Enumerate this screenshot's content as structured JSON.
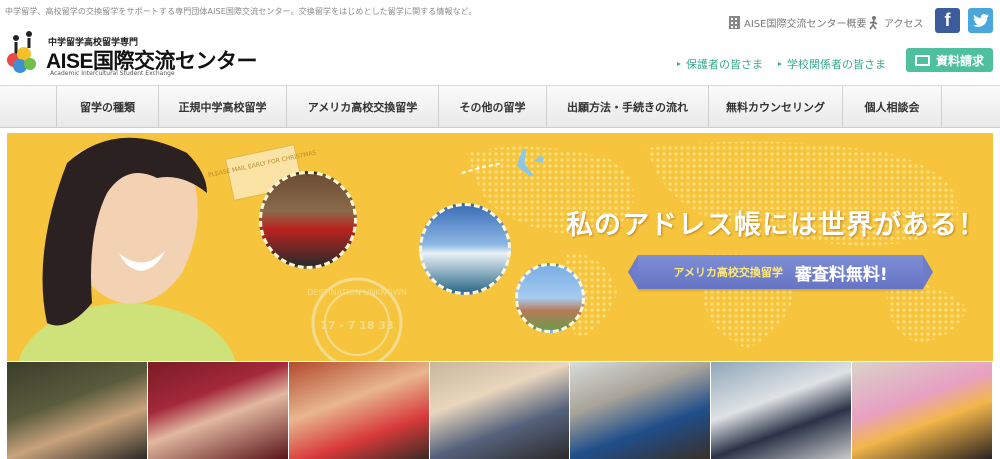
{
  "header": {
    "tagline": "中学留学、高校留学の交換留学をサポートする専門団体AISE国際交流センター。交換留学をはじめとした留学に関する情報など。",
    "logo_sub": "中学留学高校留学専門",
    "logo_main": "AISE国際交流センター",
    "logo_en": "Academic Intercultural Student Exchange",
    "about_link": "AISE国際交流センター概要",
    "access_link": "アクセス",
    "facebook_label": "f",
    "guardians_link": "保護者の皆さま",
    "schools_link": "学校関係者の皆さま",
    "request_button": "資料請求"
  },
  "nav": {
    "items": [
      "留学の種類",
      "正規中学高校留学",
      "アメリカ高校交換留学",
      "その他の留学",
      "出願方法・手続きの流れ",
      "無料カウンセリング",
      "個人相談会"
    ]
  },
  "hero": {
    "headline": "私のアドレス帳には世界がある！",
    "ribbon_small": "アメリカ高校交換留学",
    "ribbon_big": "審査料無料!",
    "postcard_text": "PLEASE MAIL EARLY FOR CHRISTMAS",
    "stamp_text": "DESTINATION UNKNOWN",
    "stamp_numbers": "17 - 7 18 33"
  },
  "strip": {
    "photos": [
      "candle-ceremony-photo",
      "graduation-group-photo",
      "smiling-students-photo",
      "family-gathering-photo",
      "school-visit-photo",
      "school-uniform-group-photo",
      "birthday-party-photo"
    ]
  },
  "colors": {
    "hero_background": "#f7c53d",
    "accent_green": "#4fc09e",
    "ribbon_blue": "#6f7cc8",
    "facebook": "#3b5b9a",
    "twitter": "#4aa7dc"
  }
}
